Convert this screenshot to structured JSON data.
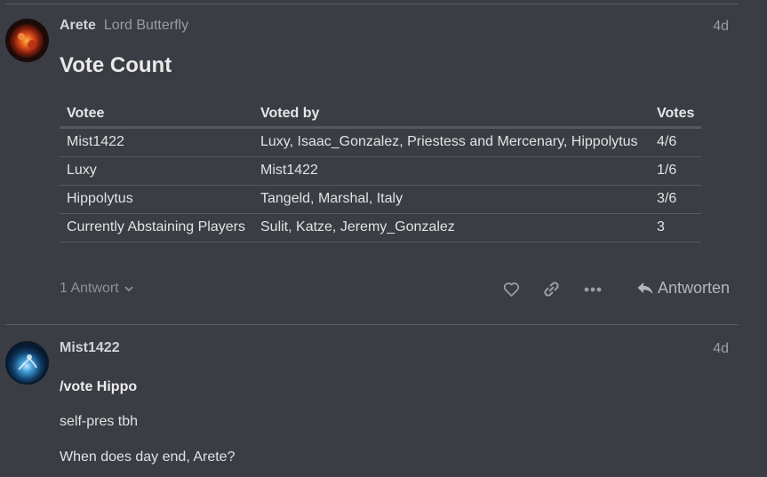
{
  "post1": {
    "username": "Arete",
    "full_name": "Lord Butterfly",
    "date": "4d",
    "title": "Vote Count",
    "table": {
      "headers": [
        "Votee",
        "Voted by",
        "Votes"
      ],
      "rows": [
        [
          "Mist1422",
          "Luxy, Isaac_Gonzalez, Priestess and Mercenary, Hippolytus",
          "4/6"
        ],
        [
          "Luxy",
          "Mist1422",
          "1/6"
        ],
        [
          "Hippolytus",
          "Tangeld, Marshal, Italy",
          "3/6"
        ],
        [
          "Currently Abstaining Players",
          "Sulit, Katze, Jeremy_Gonzalez",
          "3"
        ]
      ]
    },
    "replies_label": "1 Antwort",
    "reply_button_label": "Antworten"
  },
  "post2": {
    "username": "Mist1422",
    "date": "4d",
    "vote_line": "/vote Hippo",
    "paragraphs": [
      "self-pres tbh",
      "When does day end, Arete?"
    ]
  }
}
